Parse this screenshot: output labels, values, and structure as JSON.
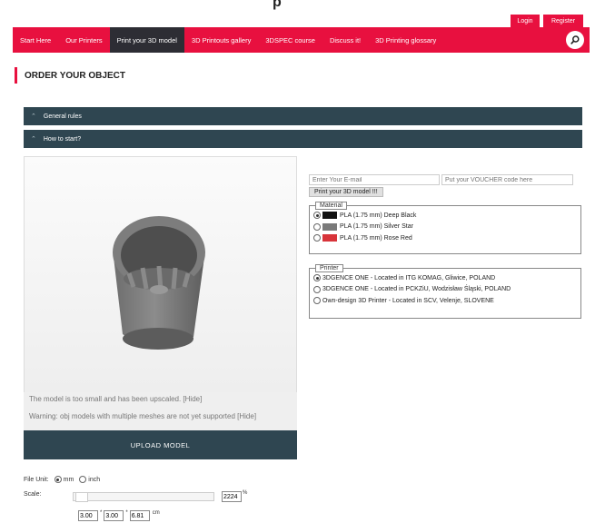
{
  "header": {
    "top_text": "p",
    "login": "Login",
    "register": "Register"
  },
  "nav": {
    "items": [
      {
        "label": "Start Here"
      },
      {
        "label": "Our Printers"
      },
      {
        "label": "Print your 3D model"
      },
      {
        "label": "3D Printouts gallery"
      },
      {
        "label": "3DSPEC course"
      },
      {
        "label": "Discuss it!"
      },
      {
        "label": "3D Printing glossary"
      }
    ],
    "active_index": 2
  },
  "page_title": "ORDER YOUR OBJECT",
  "accordion": {
    "general_rules": "General rules",
    "how_to_start": "How to start?"
  },
  "viewer": {
    "msg_upscaled": "The model is too small and has been upscaled. [Hide]",
    "msg_meshes": "Warning: obj models with multiple meshes are not yet supported [Hide]"
  },
  "upload_label": "UPLOAD MODEL",
  "order": {
    "email_placeholder": "Enter Your E-mail",
    "voucher_placeholder": "Put your VOUCHER code here",
    "print_button": "Print your 3D model !!!"
  },
  "material": {
    "legend": "Material",
    "options": [
      {
        "label": "PLA (1.75 mm) Deep Black",
        "color": "#111111",
        "selected": true
      },
      {
        "label": "PLA (1.75 mm) Silver Star",
        "color": "#7a7a7a",
        "selected": false
      },
      {
        "label": "PLA (1.75 mm) Rose Red",
        "color": "#d8343a",
        "selected": false
      }
    ]
  },
  "printer": {
    "legend": "Printer",
    "options": [
      {
        "label": "3DGENCE ONE - Located in ITG KOMAG, Gliwice, POLAND",
        "selected": true
      },
      {
        "label": "3DGENCE ONE - Located in PCKZiU, Wodzisław Śląski, POLAND",
        "selected": false
      },
      {
        "label": "Own-design 3D Printer - Located in SCV, Velenje, SLOVENE",
        "selected": false
      }
    ]
  },
  "settings": {
    "file_unit_label": "File Unit:",
    "unit_mm": "mm",
    "unit_inch": "inch",
    "scale_label": "Scale:",
    "scale_value": "2224",
    "scale_suffix": "%",
    "dims": [
      "3.00",
      "3.00",
      "6.81"
    ],
    "dim_sep": "*",
    "dim_unit": "cm"
  },
  "colors": {
    "accent": "#e8103f",
    "dark_panel": "#2f4651",
    "active_nav": "#2d2d34"
  }
}
